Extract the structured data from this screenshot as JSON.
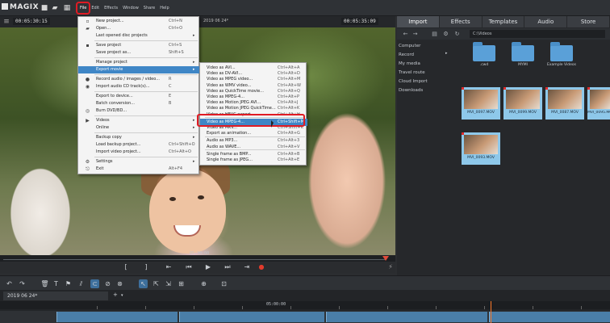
{
  "app": {
    "logo": "MAGIX"
  },
  "menubar": [
    {
      "label": "File"
    },
    {
      "label": "Edit"
    },
    {
      "label": "Effects"
    },
    {
      "label": "Window"
    },
    {
      "label": "Share"
    },
    {
      "label": "Help"
    }
  ],
  "preview": {
    "timecode_left": "00:05:30:15",
    "project_title": "2019 06 24*",
    "timecode_right": "00:05:35:09",
    "scrub_time": "05:30:00"
  },
  "file_menu": [
    {
      "label": "New project...",
      "shortcut": "Ctrl+N",
      "icon": "new-icon"
    },
    {
      "label": "Open...",
      "shortcut": "Ctrl+O",
      "icon": "open-icon"
    },
    {
      "label": "Last opened disc projects",
      "shortcut": "",
      "arrow": true
    },
    {
      "label": "Save project",
      "shortcut": "Ctrl+S",
      "icon": "save-icon"
    },
    {
      "label": "Save project as...",
      "shortcut": "Shift+S"
    },
    {
      "label": "Manage project",
      "shortcut": "",
      "arrow": true
    },
    {
      "label": "Export movie",
      "shortcut": "",
      "arrow": true,
      "highlight": true
    },
    {
      "label": "Record audio / images / video...",
      "shortcut": "R",
      "icon": "record-icon"
    },
    {
      "label": "Import audio CD track(s)...",
      "shortcut": "C",
      "icon": "cd-icon"
    },
    {
      "label": "Export to device...",
      "shortcut": "E"
    },
    {
      "label": "Batch conversion...",
      "shortcut": "B"
    },
    {
      "label": "Burn DVD/BD...",
      "shortcut": "",
      "icon": "burn-icon"
    },
    {
      "label": "Videos",
      "shortcut": "",
      "arrow": true,
      "icon": "videos-icon"
    },
    {
      "label": "Online",
      "shortcut": "",
      "arrow": true
    },
    {
      "label": "Backup copy",
      "shortcut": "",
      "arrow": true
    },
    {
      "label": "Load backup project...",
      "shortcut": "Ctrl+Shift+O"
    },
    {
      "label": "Import video project...",
      "shortcut": "Ctrl+Alt+O"
    },
    {
      "label": "Settings",
      "shortcut": "",
      "arrow": true,
      "icon": "settings-icon"
    },
    {
      "label": "Exit",
      "shortcut": "Alt+F4",
      "icon": "exit-icon"
    }
  ],
  "export_menu": [
    {
      "label": "Video as AVI...",
      "shortcut": "Ctrl+Alt+A"
    },
    {
      "label": "Video as DV-AVI...",
      "shortcut": "Ctrl+Alt+D"
    },
    {
      "label": "Video as MPEG video...",
      "shortcut": "Ctrl+Alt+M"
    },
    {
      "label": "Video as WMV video...",
      "shortcut": "Ctrl+Alt+W"
    },
    {
      "label": "Video as QuickTime movie...",
      "shortcut": "Ctrl+Alt+Q"
    },
    {
      "label": "Video as MPEG-4...",
      "shortcut": "Ctrl+Alt+P"
    },
    {
      "label": "Video as Motion JPEG AVI...",
      "shortcut": "Ctrl+Alt+J"
    },
    {
      "label": "Video as Motion JPEG QuickTime...",
      "shortcut": "Ctrl+Alt+K"
    },
    {
      "label": "Video as HEVC export",
      "shortcut": "Ctrl+Alt+H"
    },
    {
      "label": "Video as MPEG-4...",
      "shortcut": "Ctrl+Shift+M",
      "highlight": true
    },
    {
      "label": "Video as MKV...",
      "shortcut": "Ctrl+Shift+K"
    },
    {
      "label": "Export as animation...",
      "shortcut": "Ctrl+Alt+G"
    },
    {
      "label": "Audio as MP3...",
      "shortcut": "Ctrl+Alt+3"
    },
    {
      "label": "Audio as WAVE...",
      "shortcut": "Ctrl+Alt+V"
    },
    {
      "label": "Single frame as BMP...",
      "shortcut": "Ctrl+Alt+B"
    },
    {
      "label": "Single frame as JPEG...",
      "shortcut": "Ctrl+Alt+E"
    }
  ],
  "panel": {
    "tabs": [
      {
        "label": "Import",
        "active": true
      },
      {
        "label": "Effects"
      },
      {
        "label": "Templates"
      },
      {
        "label": "Audio"
      },
      {
        "label": "Store"
      }
    ],
    "path": "C:\\Videos",
    "tree": [
      "Computer",
      "Record",
      "My media",
      "Travel route",
      "Cloud Import",
      "Downloads"
    ],
    "folders": [
      {
        "name": ".cwd"
      },
      {
        "name": "MYMI"
      },
      {
        "name": "Example Videos"
      }
    ],
    "thumbs": [
      {
        "name": "MVI_0097.MOV"
      },
      {
        "name": "MVI_0099.MOV"
      },
      {
        "name": "MVI_0087.MOV"
      },
      {
        "name": "MVI_0095.MOV"
      },
      {
        "name": "MVI_0093.MOV"
      }
    ]
  },
  "timeline": {
    "tab_title": "2019 06 24*",
    "ruler_time": "05:00:00"
  }
}
